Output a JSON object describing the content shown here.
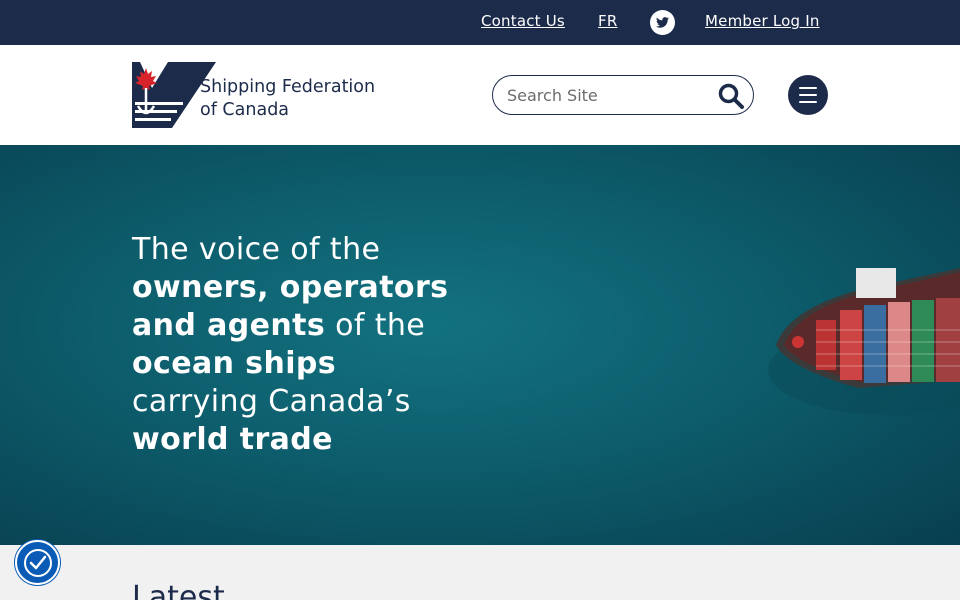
{
  "topbar": {
    "contact_label": "Contact Us",
    "fr_label": "FR",
    "twitter_icon": "twitter-icon",
    "login_label": "Member Log In"
  },
  "header": {
    "logo_line1": "Shipping Federation",
    "logo_line2": "of Canada",
    "search_placeholder": "Search Site",
    "search_icon": "search-icon",
    "menu_icon": "hamburger-menu-icon"
  },
  "hero": {
    "line1_regular": "The voice of the",
    "line2_bold": "owners, operators",
    "line3_bold": "and agents",
    "line3_regular": " of the",
    "line4_bold": "ocean ships",
    "line5_regular": "carrying Canada’s",
    "line6_bold": "world trade",
    "image": "container-ship-aerial"
  },
  "next_section": {
    "heading_partial": "Latest"
  },
  "accessibility_icon": "accessibility-icon",
  "colors": {
    "navy": "#1c2b4a",
    "teal": "#0d5d6c",
    "accessibility_blue": "#0a5bb5",
    "maple_red": "#d6242a"
  }
}
